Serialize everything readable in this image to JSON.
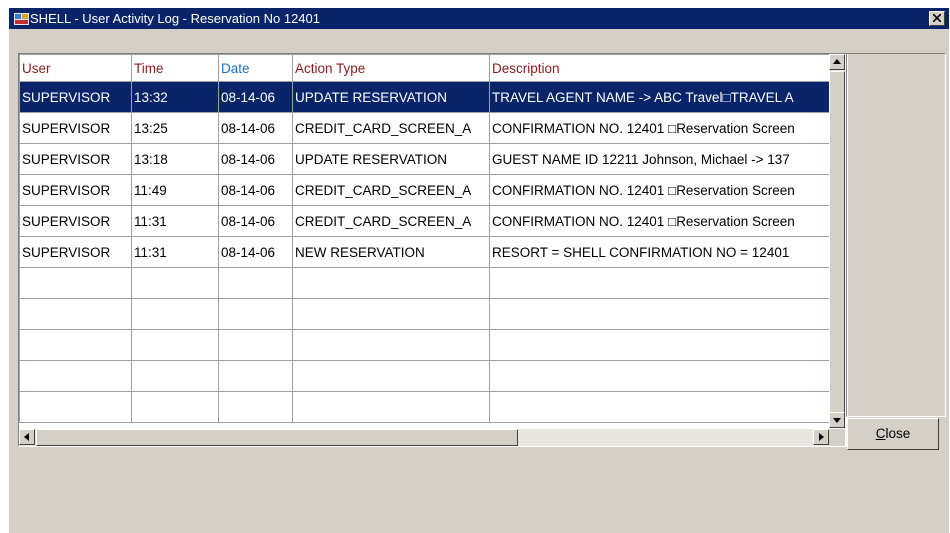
{
  "window": {
    "title": "SHELL - User Activity Log - Reservation No 12401",
    "close_icon": "close-x-icon"
  },
  "grid": {
    "columns": [
      "User",
      "Time",
      "Date",
      "Action Type",
      "Description"
    ],
    "rows": [
      [
        "SUPERVISOR",
        "13:32",
        "08-14-06",
        "UPDATE RESERVATION",
        "TRAVEL AGENT NAME  -> ABC Travel□TRAVEL A"
      ],
      [
        "SUPERVISOR",
        "13:25",
        "08-14-06",
        "CREDIT_CARD_SCREEN_A",
        "CONFIRMATION NO. 12401 □Reservation Screen"
      ],
      [
        "SUPERVISOR",
        "13:18",
        "08-14-06",
        "UPDATE RESERVATION",
        "GUEST NAME ID 12211 Johnson, Michael -> 137"
      ],
      [
        "SUPERVISOR",
        "11:49",
        "08-14-06",
        "CREDIT_CARD_SCREEN_A",
        "CONFIRMATION NO. 12401 □Reservation Screen"
      ],
      [
        "SUPERVISOR",
        "11:31",
        "08-14-06",
        "CREDIT_CARD_SCREEN_A",
        "CONFIRMATION NO. 12401 □Reservation Screen"
      ],
      [
        "SUPERVISOR",
        "11:31",
        "08-14-06",
        "NEW RESERVATION",
        "RESORT = SHELL CONFIRMATION NO = 12401"
      ]
    ],
    "empty_rows": 5,
    "selected_row": 0
  },
  "buttons": {
    "close_mnemonic": "C",
    "close_rest": "lose"
  },
  "colors": {
    "titlebar": "#0a246a",
    "header_text": "#8b1a1a",
    "date_header_text": "#1e6ec8",
    "selection": "#0a246a",
    "window_bg": "#d4d0c8"
  }
}
